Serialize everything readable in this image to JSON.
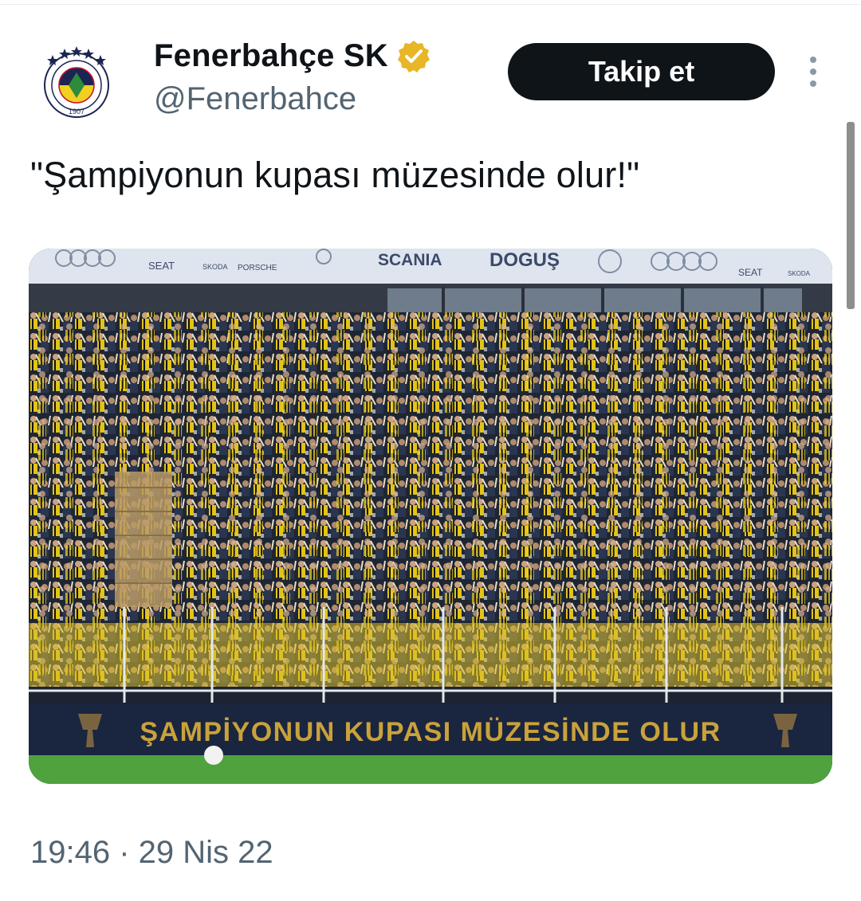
{
  "account": {
    "display_name": "Fenerbahçe SK",
    "handle": "@Fenerbahce",
    "verified_icon": "verified-badge-icon",
    "avatar_icon": "club-crest-icon",
    "crest_year": "1907"
  },
  "actions": {
    "follow_label": "Takip et",
    "more_icon": "more-vertical-icon"
  },
  "tweet": {
    "text": "\"Şampiyonun kupası müzesinde olur!\"",
    "timestamp": "19:46 · 29 Nis 22"
  },
  "media": {
    "sponsors": [
      "SEAT",
      "SKODA",
      "PORSCHE",
      "SCANIA",
      "DOGUŞ"
    ],
    "banner_text": "ŞAMPİYONUN KUPASI MÜZESİNDE OLUR"
  },
  "colors": {
    "follow_bg": "#0f1419",
    "handle": "#536471",
    "verified": "#e8b626",
    "club_yellow": "#f2d022",
    "club_navy": "#1b2552"
  }
}
